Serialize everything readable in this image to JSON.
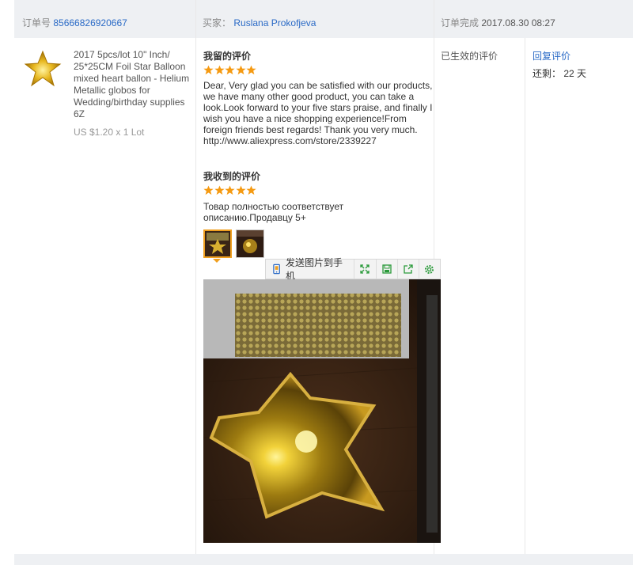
{
  "header": {
    "order_label": "订单号",
    "order_number": "85666826920667",
    "buyer_label": "买家：",
    "buyer_name": "Ruslana Prokofjeva",
    "complete_label": "订单完成",
    "complete_time": "2017.08.30 08:27"
  },
  "product": {
    "title": "2017 5pcs/lot 10\" Inch/ 25*25CM Foil Star Balloon mixed heart ballon - Helium Metallic globos for Wedding/birthday supplies 6Z",
    "price": "US $1.20 x 1 Lot",
    "thumb_icon": "gold-star-balloon"
  },
  "left_review": {
    "title": "我留的评价",
    "stars": 5,
    "text": "Dear, Very glad you can be satisfied with our products, we have many other good product, you can take a look.Look forward to your five stars praise, and finally I wish you have a nice shopping experience!From foreign friends best regards! Thank you very much.",
    "url": "http://www.aliexpress.com/store/2339227"
  },
  "received_review": {
    "title": "我收到的评价",
    "stars": 5,
    "text": "Товар полностью соответствует описанию.Продавцу 5+"
  },
  "toolbar": {
    "send_label": "发送图片到手机",
    "icons": [
      "phone-send-icon",
      "fullscreen-icon",
      "save-icon",
      "share-icon",
      "settings-icon"
    ]
  },
  "status": {
    "label": "已生效的评价"
  },
  "actions": {
    "reply_label": "回复评价",
    "remaining_label": "还剩：",
    "remaining_days": "22 天"
  },
  "colors": {
    "link": "#2a6ac6",
    "star": "#f59a12",
    "header_bg": "#eef0f3"
  }
}
